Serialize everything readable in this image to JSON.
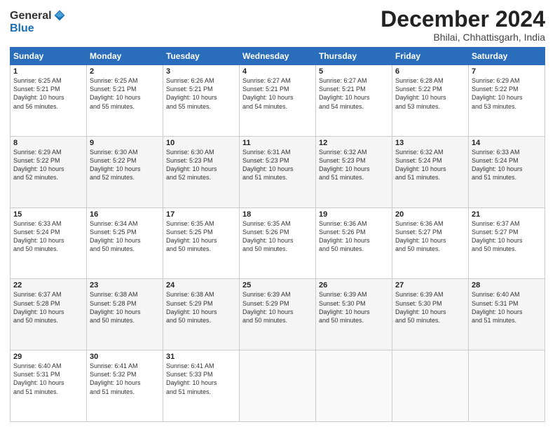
{
  "logo": {
    "general": "General",
    "blue": "Blue"
  },
  "header": {
    "month": "December 2024",
    "location": "Bhilai, Chhattisgarh, India"
  },
  "days_of_week": [
    "Sunday",
    "Monday",
    "Tuesday",
    "Wednesday",
    "Thursday",
    "Friday",
    "Saturday"
  ],
  "weeks": [
    [
      {
        "day": "1",
        "sunrise": "6:25 AM",
        "sunset": "5:21 PM",
        "daylight": "10 hours and 56 minutes."
      },
      {
        "day": "2",
        "sunrise": "6:25 AM",
        "sunset": "5:21 PM",
        "daylight": "10 hours and 55 minutes."
      },
      {
        "day": "3",
        "sunrise": "6:26 AM",
        "sunset": "5:21 PM",
        "daylight": "10 hours and 55 minutes."
      },
      {
        "day": "4",
        "sunrise": "6:27 AM",
        "sunset": "5:21 PM",
        "daylight": "10 hours and 54 minutes."
      },
      {
        "day": "5",
        "sunrise": "6:27 AM",
        "sunset": "5:21 PM",
        "daylight": "10 hours and 54 minutes."
      },
      {
        "day": "6",
        "sunrise": "6:28 AM",
        "sunset": "5:22 PM",
        "daylight": "10 hours and 53 minutes."
      },
      {
        "day": "7",
        "sunrise": "6:29 AM",
        "sunset": "5:22 PM",
        "daylight": "10 hours and 53 minutes."
      }
    ],
    [
      {
        "day": "8",
        "sunrise": "6:29 AM",
        "sunset": "5:22 PM",
        "daylight": "10 hours and 52 minutes."
      },
      {
        "day": "9",
        "sunrise": "6:30 AM",
        "sunset": "5:22 PM",
        "daylight": "10 hours and 52 minutes."
      },
      {
        "day": "10",
        "sunrise": "6:30 AM",
        "sunset": "5:23 PM",
        "daylight": "10 hours and 52 minutes."
      },
      {
        "day": "11",
        "sunrise": "6:31 AM",
        "sunset": "5:23 PM",
        "daylight": "10 hours and 51 minutes."
      },
      {
        "day": "12",
        "sunrise": "6:32 AM",
        "sunset": "5:23 PM",
        "daylight": "10 hours and 51 minutes."
      },
      {
        "day": "13",
        "sunrise": "6:32 AM",
        "sunset": "5:24 PM",
        "daylight": "10 hours and 51 minutes."
      },
      {
        "day": "14",
        "sunrise": "6:33 AM",
        "sunset": "5:24 PM",
        "daylight": "10 hours and 51 minutes."
      }
    ],
    [
      {
        "day": "15",
        "sunrise": "6:33 AM",
        "sunset": "5:24 PM",
        "daylight": "10 hours and 50 minutes."
      },
      {
        "day": "16",
        "sunrise": "6:34 AM",
        "sunset": "5:25 PM",
        "daylight": "10 hours and 50 minutes."
      },
      {
        "day": "17",
        "sunrise": "6:35 AM",
        "sunset": "5:25 PM",
        "daylight": "10 hours and 50 minutes."
      },
      {
        "day": "18",
        "sunrise": "6:35 AM",
        "sunset": "5:26 PM",
        "daylight": "10 hours and 50 minutes."
      },
      {
        "day": "19",
        "sunrise": "6:36 AM",
        "sunset": "5:26 PM",
        "daylight": "10 hours and 50 minutes."
      },
      {
        "day": "20",
        "sunrise": "6:36 AM",
        "sunset": "5:27 PM",
        "daylight": "10 hours and 50 minutes."
      },
      {
        "day": "21",
        "sunrise": "6:37 AM",
        "sunset": "5:27 PM",
        "daylight": "10 hours and 50 minutes."
      }
    ],
    [
      {
        "day": "22",
        "sunrise": "6:37 AM",
        "sunset": "5:28 PM",
        "daylight": "10 hours and 50 minutes."
      },
      {
        "day": "23",
        "sunrise": "6:38 AM",
        "sunset": "5:28 PM",
        "daylight": "10 hours and 50 minutes."
      },
      {
        "day": "24",
        "sunrise": "6:38 AM",
        "sunset": "5:29 PM",
        "daylight": "10 hours and 50 minutes."
      },
      {
        "day": "25",
        "sunrise": "6:39 AM",
        "sunset": "5:29 PM",
        "daylight": "10 hours and 50 minutes."
      },
      {
        "day": "26",
        "sunrise": "6:39 AM",
        "sunset": "5:30 PM",
        "daylight": "10 hours and 50 minutes."
      },
      {
        "day": "27",
        "sunrise": "6:39 AM",
        "sunset": "5:30 PM",
        "daylight": "10 hours and 50 minutes."
      },
      {
        "day": "28",
        "sunrise": "6:40 AM",
        "sunset": "5:31 PM",
        "daylight": "10 hours and 51 minutes."
      }
    ],
    [
      {
        "day": "29",
        "sunrise": "6:40 AM",
        "sunset": "5:31 PM",
        "daylight": "10 hours and 51 minutes."
      },
      {
        "day": "30",
        "sunrise": "6:41 AM",
        "sunset": "5:32 PM",
        "daylight": "10 hours and 51 minutes."
      },
      {
        "day": "31",
        "sunrise": "6:41 AM",
        "sunset": "5:33 PM",
        "daylight": "10 hours and 51 minutes."
      },
      null,
      null,
      null,
      null
    ]
  ],
  "labels": {
    "sunrise": "Sunrise:",
    "sunset": "Sunset:",
    "daylight": "Daylight:"
  }
}
